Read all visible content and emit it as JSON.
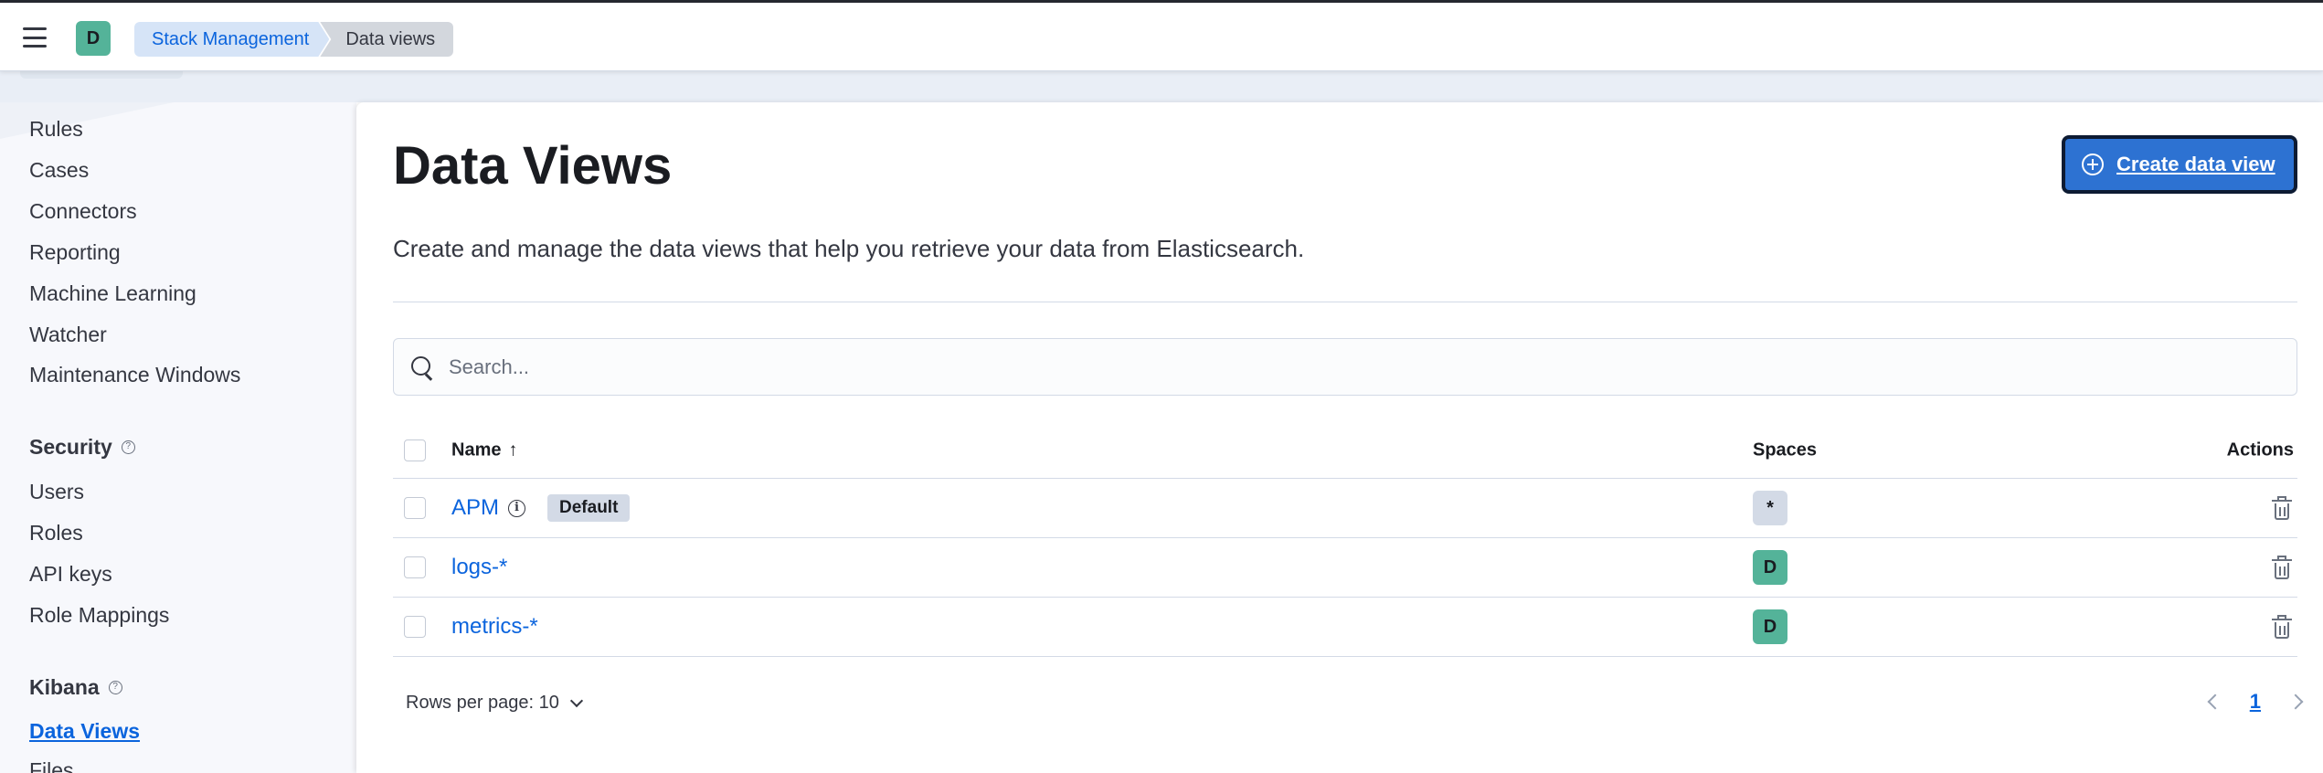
{
  "header": {
    "space_initial": "D",
    "breadcrumbs": [
      "Stack Management",
      "Data views"
    ]
  },
  "sidebar": {
    "items_top": [
      "Rules",
      "Cases",
      "Connectors",
      "Reporting",
      "Machine Learning",
      "Watcher",
      "Maintenance Windows"
    ],
    "security": {
      "heading": "Security",
      "items": [
        "Users",
        "Roles",
        "API keys",
        "Role Mappings"
      ]
    },
    "kibana": {
      "heading": "Kibana",
      "items": [
        "Data Views",
        "Files"
      ]
    }
  },
  "main": {
    "title": "Data Views",
    "create_button": "Create data view",
    "description": "Create and manage the data views that help you retrieve your data from Elasticsearch.",
    "search_placeholder": "Search...",
    "table": {
      "headers": {
        "name": "Name",
        "spaces": "Spaces",
        "actions": "Actions"
      },
      "rows": [
        {
          "name": "APM",
          "badge": "Default",
          "space": "*"
        },
        {
          "name": "logs-*",
          "space": "D"
        },
        {
          "name": "metrics-*",
          "space": "D"
        }
      ]
    },
    "rows_per_page": "Rows per page: 10",
    "current_page": "1"
  },
  "colors": {
    "accent": "#0b64dd",
    "primary_button": "#2d72d2",
    "space_avatar": "#54b399"
  }
}
